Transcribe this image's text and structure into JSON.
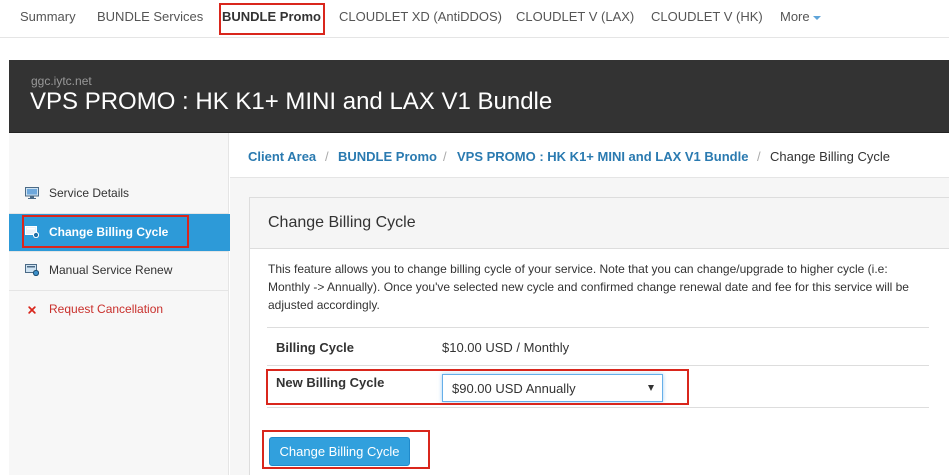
{
  "topnav": {
    "items": [
      "Summary",
      "BUNDLE Services",
      "BUNDLE Promo",
      "CLOUDLET XD (AntiDDOS)",
      "CLOUDLET V (LAX)",
      "CLOUDLET V (HK)",
      "More"
    ],
    "active_index": 2
  },
  "header": {
    "domain": "ggc.iytc.net",
    "title": "VPS PROMO : HK K1+ MINI and LAX V1 Bundle"
  },
  "sidebar": {
    "items": [
      {
        "label": "Service Details",
        "icon": "monitor-icon"
      },
      {
        "label": "Change Billing Cycle",
        "icon": "billing-cycle-icon"
      },
      {
        "label": "Manual Service Renew",
        "icon": "renew-icon"
      },
      {
        "label": "Request Cancellation",
        "icon": "cross-icon"
      }
    ],
    "active_index": 1
  },
  "breadcrumb": {
    "items": [
      "Client Area",
      "BUNDLE Promo",
      "VPS PROMO : HK K1+ MINI and LAX V1 Bundle",
      "Change Billing Cycle"
    ],
    "separator": "/"
  },
  "panel": {
    "title": "Change Billing Cycle",
    "description": "This feature allows you to change billing cycle of your service. Note that you can change/upgrade to higher cycle (i.e: Monthly -> Annually). Once you've selected new cycle and confirmed change renewal date and fee for this service will be adjusted accordingly.",
    "billing_cycle_label": "Billing Cycle",
    "billing_cycle_value": "$10.00 USD / Monthly",
    "new_cycle_label": "New Billing Cycle",
    "new_cycle_selected": "$90.00 USD Annually",
    "submit_label": "Change Billing Cycle"
  },
  "colors": {
    "accent": "#2d9ad8",
    "highlight_box": "#d9261c",
    "header_bg": "#333333",
    "link": "#2a7ab0",
    "danger": "#c9302c"
  }
}
